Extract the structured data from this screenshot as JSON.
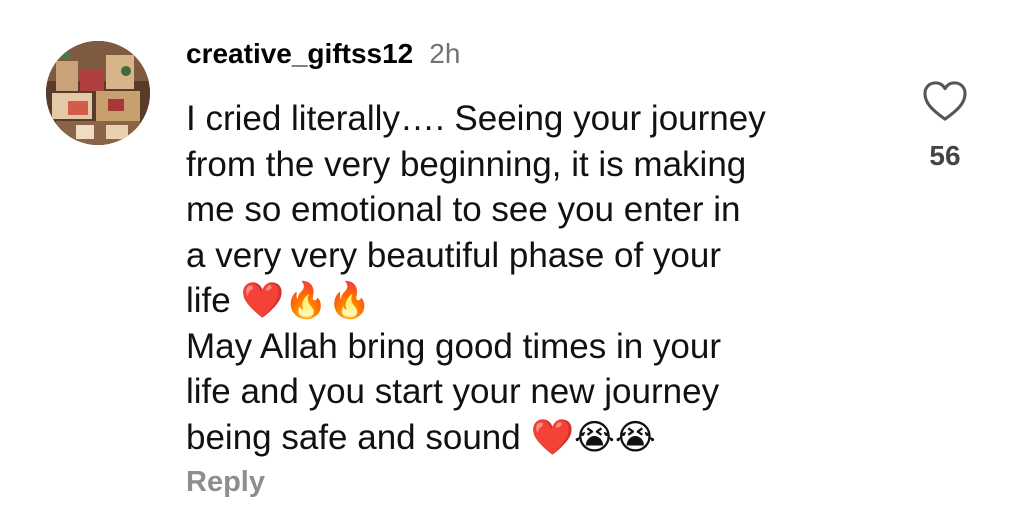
{
  "comment": {
    "avatar_icon": "gift-basket-avatar",
    "username": "creative_giftss12",
    "time_ago": "2h",
    "text": "I cried literally…. Seeing your journey\nfrom the very beginning, it is making\nme so emotional to see you enter in\na very very beautiful phase of your\nlife ❤️🔥🔥\nMay Allah bring good times in your\nlife and you start your new journey\nbeing safe and sound ❤️😭😭",
    "reply_label": "Reply",
    "like_icon": "heart-outline-icon",
    "like_count": "56"
  },
  "colors": {
    "text": "#111111",
    "secondary": "#737373",
    "reply": "#8e8e8e",
    "like_count": "#444444",
    "background": "#ffffff"
  }
}
